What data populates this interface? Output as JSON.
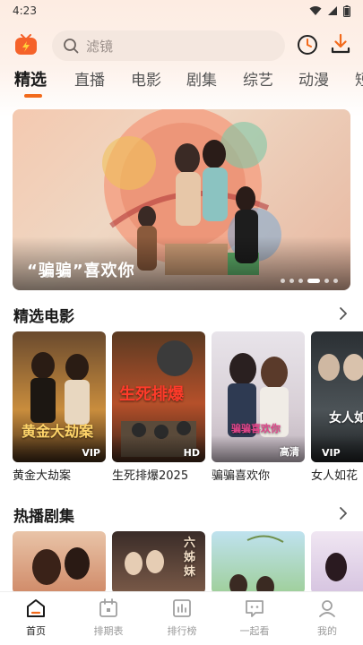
{
  "status_bar": {
    "time": "4:23"
  },
  "search": {
    "placeholder": "滤镜"
  },
  "tabs": [
    {
      "label": "精选",
      "active": true
    },
    {
      "label": "直播"
    },
    {
      "label": "电影"
    },
    {
      "label": "剧集"
    },
    {
      "label": "综艺"
    },
    {
      "label": "动漫"
    },
    {
      "label": "短"
    }
  ],
  "banner": {
    "title": "“骗骗”喜欢你",
    "slides": 6,
    "active_slide": 5
  },
  "featured_movies": {
    "title": "精选电影",
    "items": [
      {
        "title": "黄金大劫案",
        "badge": "VIP",
        "poster_text": "黄金大劫案"
      },
      {
        "title": "生死排爆2025",
        "badge": "HD",
        "poster_text": "生死排爆"
      },
      {
        "title": "骗骗喜欢你",
        "badge": "高清",
        "poster_text": "骗骗喜欢你"
      },
      {
        "title": "女人如花",
        "badge": "VIP",
        "poster_text": "女人如花"
      }
    ]
  },
  "hot_series": {
    "title": "热播剧集",
    "items": [
      {
        "poster_text": ""
      },
      {
        "poster_text": "六姊妹"
      },
      {
        "poster_text": ""
      },
      {
        "poster_text": ""
      }
    ]
  },
  "bottom_nav": [
    {
      "label": "首页",
      "icon": "home-icon",
      "active": true
    },
    {
      "label": "排期表",
      "icon": "calendar-icon"
    },
    {
      "label": "排行榜",
      "icon": "ranking-icon"
    },
    {
      "label": "一起看",
      "icon": "watch-together-icon"
    },
    {
      "label": "我的",
      "icon": "profile-icon"
    }
  ],
  "colors": {
    "accent": "#f26a1b",
    "active_text": "#1a1a1a",
    "inactive_text": "#9a9a9a"
  }
}
